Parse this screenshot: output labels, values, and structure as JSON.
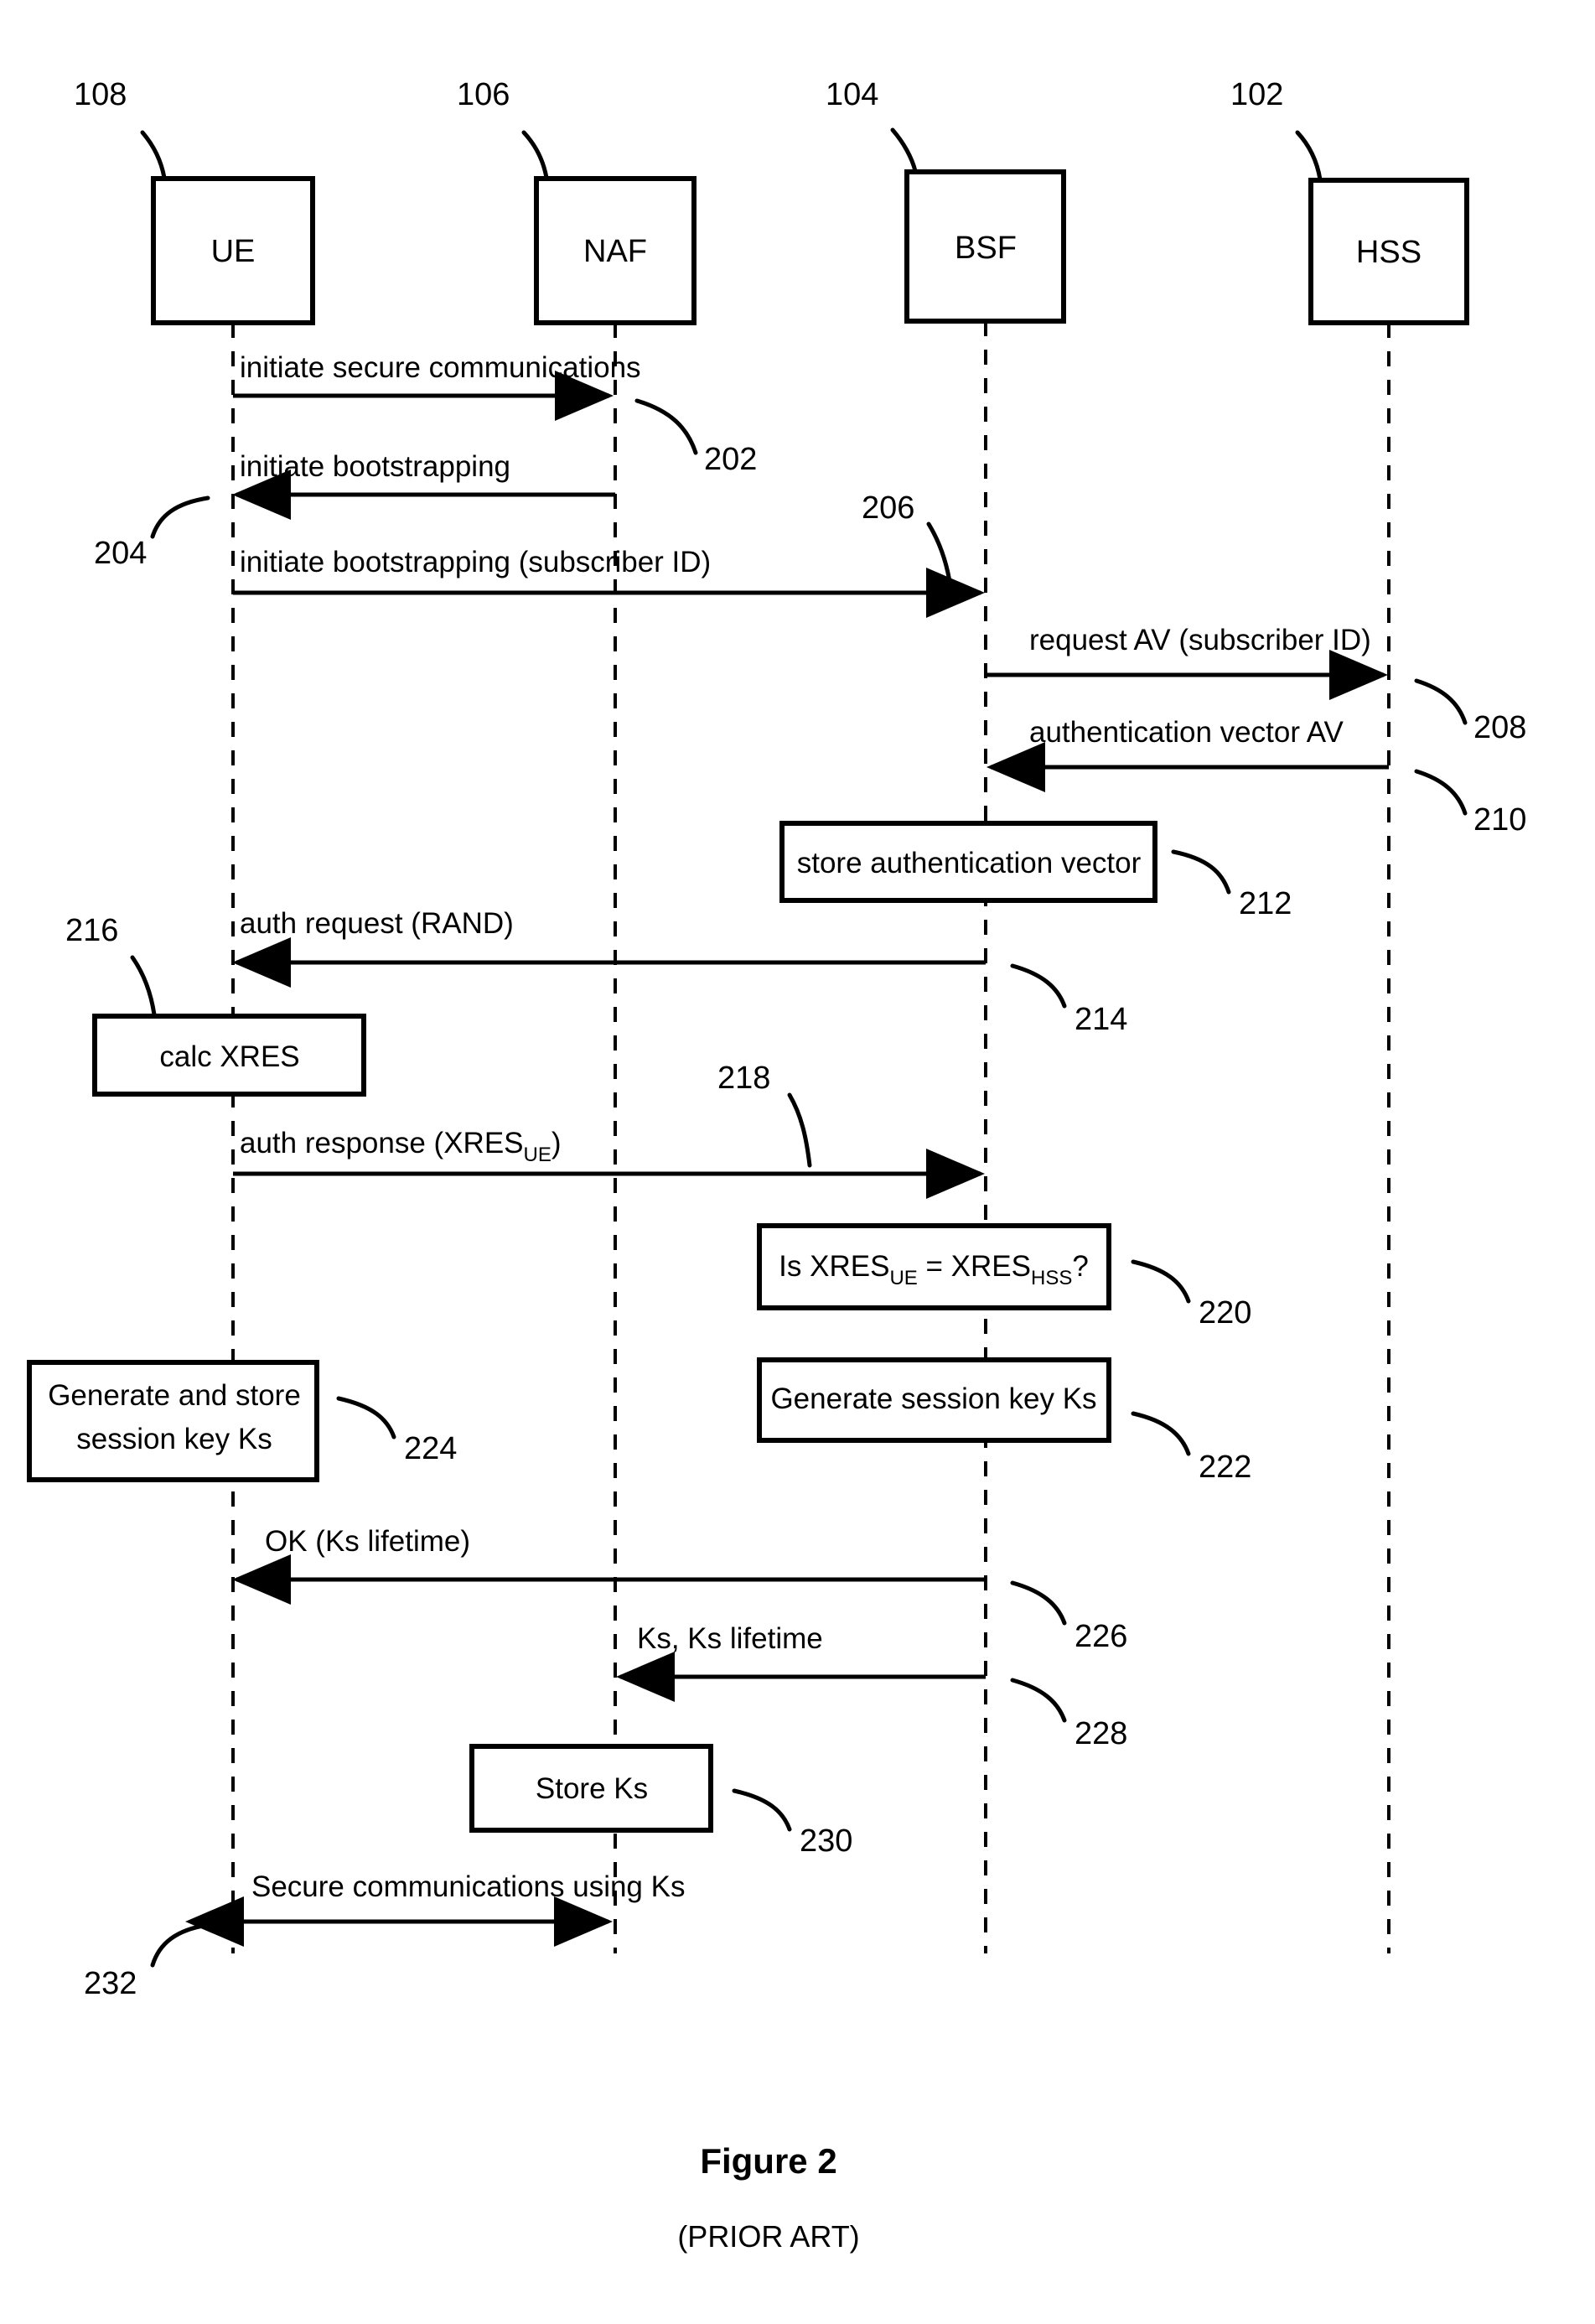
{
  "figure": {
    "title": "Figure 2",
    "subtitle": "(PRIOR ART)"
  },
  "nodes": [
    {
      "id": "ue",
      "label": "UE",
      "ref": "108"
    },
    {
      "id": "naf",
      "label": "NAF",
      "ref": "106"
    },
    {
      "id": "bsf",
      "label": "BSF",
      "ref": "104"
    },
    {
      "id": "hss",
      "label": "HSS",
      "ref": "102"
    }
  ],
  "messages": [
    {
      "ref": "202",
      "label": "initiate secure communications",
      "from": "ue",
      "to": "naf",
      "direction": "right"
    },
    {
      "ref": "204",
      "label": "initiate bootstrapping",
      "from": "naf",
      "to": "ue",
      "direction": "left"
    },
    {
      "ref": "206",
      "label": "initiate bootstrapping (subscriber ID)",
      "from": "ue",
      "to": "bsf",
      "direction": "right"
    },
    {
      "ref": "208",
      "label": "request AV (subscriber ID)",
      "from": "bsf",
      "to": "hss",
      "direction": "right"
    },
    {
      "ref": "210",
      "label": "authentication vector AV",
      "from": "hss",
      "to": "bsf",
      "direction": "left"
    },
    {
      "ref": "214",
      "label": "auth request (RAND)",
      "from": "bsf",
      "to": "ue",
      "direction": "left"
    },
    {
      "ref": "218",
      "label_main": "auth response (XRES",
      "label_sub": "UE",
      "label_tail": ")",
      "label": "auth response (XRESUE)",
      "from": "ue",
      "to": "bsf",
      "direction": "right"
    },
    {
      "ref": "226",
      "label": "OK (Ks lifetime)",
      "from": "bsf",
      "to": "ue",
      "direction": "left"
    },
    {
      "ref": "228",
      "label": "Ks, Ks lifetime",
      "from": "bsf",
      "to": "naf",
      "direction": "left"
    },
    {
      "ref": "232",
      "label": "Secure communications using Ks",
      "from": "ue",
      "to": "naf",
      "direction": "both"
    }
  ],
  "action_boxes": [
    {
      "ref": "212",
      "lines": [
        "store authentication vector"
      ],
      "on": "bsf"
    },
    {
      "ref": "216",
      "lines": [
        "calc XRES"
      ],
      "on": "ue"
    },
    {
      "ref": "220",
      "formula": {
        "pre": "Is XRES",
        "sub1": "UE",
        "mid": " = XRES",
        "sub2": "HSS",
        "post": "?"
      },
      "lines": [
        "Is XRESUE = XRESHSS?"
      ],
      "on": "bsf"
    },
    {
      "ref": "224",
      "lines": [
        "Generate and store",
        "session key Ks"
      ],
      "on": "ue"
    },
    {
      "ref": "222",
      "lines": [
        "Generate session key Ks"
      ],
      "on": "bsf"
    },
    {
      "ref": "230",
      "lines": [
        "Store Ks"
      ],
      "on": "naf"
    }
  ],
  "colors": {
    "ink": "#000000",
    "paper": "#ffffff"
  }
}
